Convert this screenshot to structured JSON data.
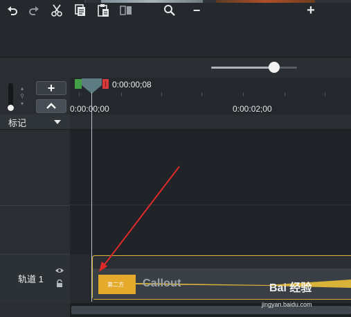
{
  "toolbar": {
    "icons": [
      "undo-icon",
      "redo-icon",
      "cut-icon",
      "copy-icon",
      "paste-icon",
      "split-icon",
      "zoom-icon",
      "zoom-out-icon",
      "zoom-in-icon"
    ],
    "zoom_minus": "−",
    "zoom_plus": "+",
    "zoom_level": 0.7
  },
  "left_panel": {
    "add_track_label": "+",
    "collapse_label": "⌃"
  },
  "timeline": {
    "playhead_time": "0:00:00;08",
    "ruler_labels": [
      "0:00:00;00",
      "0:00:02;00"
    ]
  },
  "markers": {
    "label": "标记"
  },
  "tracks": [
    {
      "label": "轨道 1"
    }
  ],
  "clip": {
    "name": "Callout",
    "thumb_text": "第二方"
  },
  "watermark": {
    "brand": "Bai 经验",
    "url": "jingyan.baidu.com"
  },
  "colors": {
    "clip_border": "#d9b23a",
    "callout_fill": "#e5a92c",
    "annotation_arrow": "#e02a2a",
    "marker_in": "#43a047",
    "marker_out": "#d63a3a"
  }
}
